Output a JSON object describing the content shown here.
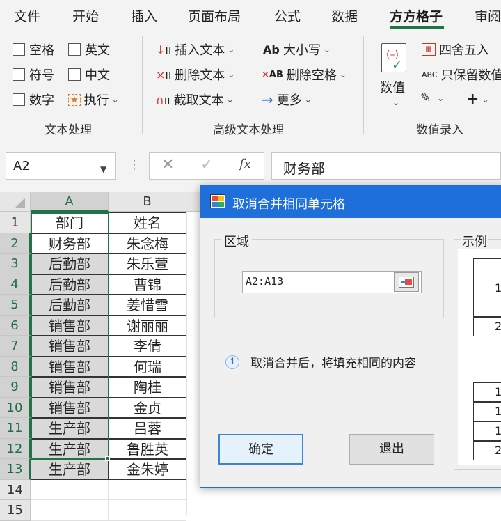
{
  "menu": {
    "tabs": [
      "文件",
      "开始",
      "插入",
      "页面布局",
      "公式",
      "数据",
      "方方格子",
      "审阅"
    ],
    "active_tab": "方方格子"
  },
  "ribbon": {
    "text_group": {
      "label": "文本处理",
      "checkboxes": [
        "空格",
        "英文",
        "符号",
        "中文",
        "数字"
      ],
      "execute": "执行"
    },
    "adv_group": {
      "label": "高级文本处理",
      "insert_text": "插入文本",
      "delete_text": "删除文本",
      "extract_text": "截取文本",
      "case": "大小写",
      "case_icon_text": "Ab",
      "delete_space": "删除空格",
      "delete_space_icon_text": "AB",
      "more": "更多"
    },
    "num_group": {
      "label": "数值录入",
      "value_btn": "数值",
      "round": "四舍五入",
      "keep_value": "只保留数值",
      "keep_value_icon_text": "ABC"
    }
  },
  "formula_bar": {
    "name_box": "A2",
    "formula": "财务部"
  },
  "sheet": {
    "columns": [
      "A",
      "B"
    ],
    "row_numbers": [
      "1",
      "2",
      "3",
      "4",
      "5",
      "6",
      "7",
      "8",
      "9",
      "10",
      "11",
      "12",
      "13",
      "14",
      "15"
    ],
    "rows": [
      [
        "部门",
        "姓名"
      ],
      [
        "财务部",
        "朱念梅"
      ],
      [
        "后勤部",
        "朱乐萱"
      ],
      [
        "后勤部",
        "曹锦"
      ],
      [
        "后勤部",
        "姜惜雪"
      ],
      [
        "销售部",
        "谢丽丽"
      ],
      [
        "销售部",
        "李倩"
      ],
      [
        "销售部",
        "何瑞"
      ],
      [
        "销售部",
        "陶桂"
      ],
      [
        "销售部",
        "金贞"
      ],
      [
        "生产部",
        "吕蓉"
      ],
      [
        "生产部",
        "鲁胜英"
      ],
      [
        "生产部",
        "金朱婷"
      ]
    ]
  },
  "dialog": {
    "title": "取消合并相同单元格",
    "region_label": "区域",
    "range_value": "A2:A13",
    "info": "取消合并后，将填充相同的内容",
    "ok": "确定",
    "exit": "退出",
    "example_label": "示例",
    "example_cells": [
      "1",
      "2",
      "1",
      "1",
      "1",
      "2"
    ]
  }
}
